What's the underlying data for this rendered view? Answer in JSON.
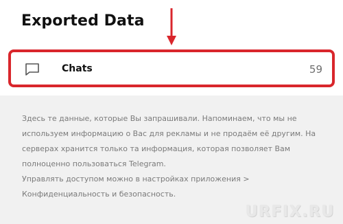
{
  "header": {
    "title": "Exported Data"
  },
  "chats_row": {
    "icon": "chat-bubble-icon",
    "label": "Chats",
    "count": "59"
  },
  "info": {
    "paragraph1": "Здесь те данные, которые Вы запрашивали. Напоминаем, что мы не используем информацию о Вас для рекламы и не продаём её другим. На серверах хранится только та информация, которая позволяет Вам полноценно пользоваться Telegram.",
    "paragraph2": "Управлять доступом можно в настройках приложения > Конфиденциальность и безопасность."
  },
  "watermark": {
    "text": "URFIX.RU"
  },
  "colors": {
    "highlight": "#d9262c",
    "background": "#f1f1f1",
    "panel": "#ffffff",
    "muted_text": "#7a7a7a"
  }
}
